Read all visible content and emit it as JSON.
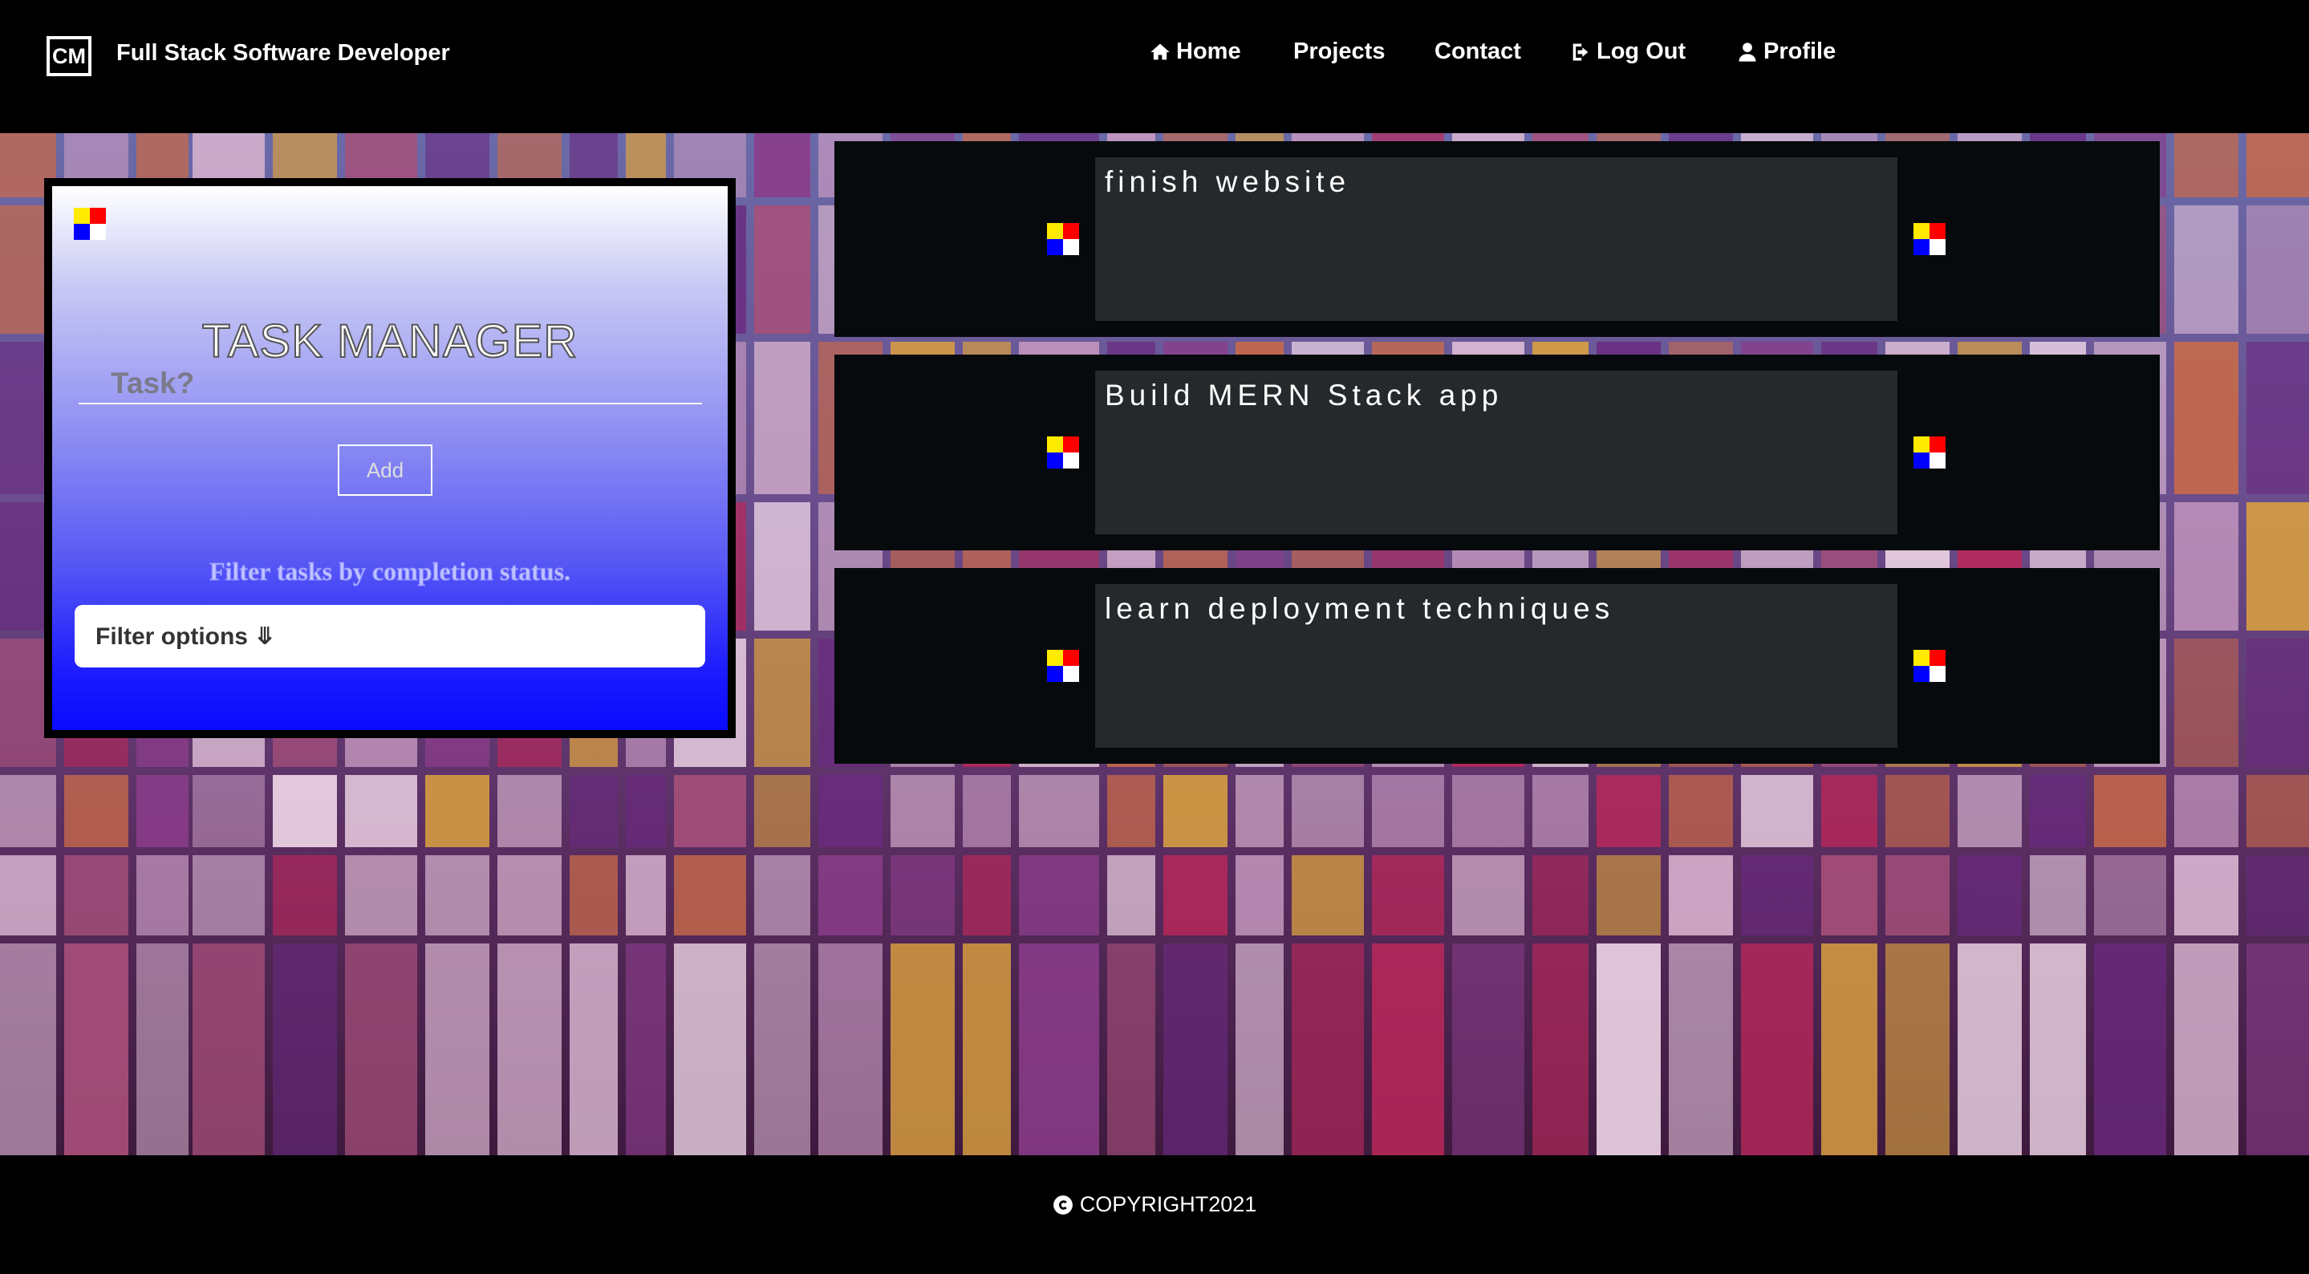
{
  "navbar": {
    "logo_text": "CM",
    "brand_name": "Full Stack Software Developer",
    "links": [
      {
        "label": "Home",
        "icon": "home-icon"
      },
      {
        "label": "Projects"
      },
      {
        "label": "Contact"
      },
      {
        "label": "Log Out",
        "icon": "logout-icon"
      },
      {
        "label": "Profile",
        "icon": "user-icon"
      }
    ]
  },
  "task_manager": {
    "title": "TASK MANAGER",
    "input_placeholder": "Task?",
    "input_value": "",
    "add_label": "Add",
    "filter_caption": "Filter tasks by completion status.",
    "filter_selected": "Filter options ⤋"
  },
  "tasks": [
    {
      "text": "finish website"
    },
    {
      "text": "Build MERN Stack app"
    },
    {
      "text": "learn deployment techniques"
    }
  ],
  "footer": {
    "copyright_text": "COPYRIGHT2021",
    "icon": "copyright-icon"
  },
  "colors": {
    "mondrian_yellow": "#ffea00",
    "mondrian_red": "#ff0000",
    "mondrian_blue": "#0000ff",
    "mondrian_white": "#ffffff",
    "card_bg": "#070a0c",
    "task_text_bg": "#25292b"
  }
}
